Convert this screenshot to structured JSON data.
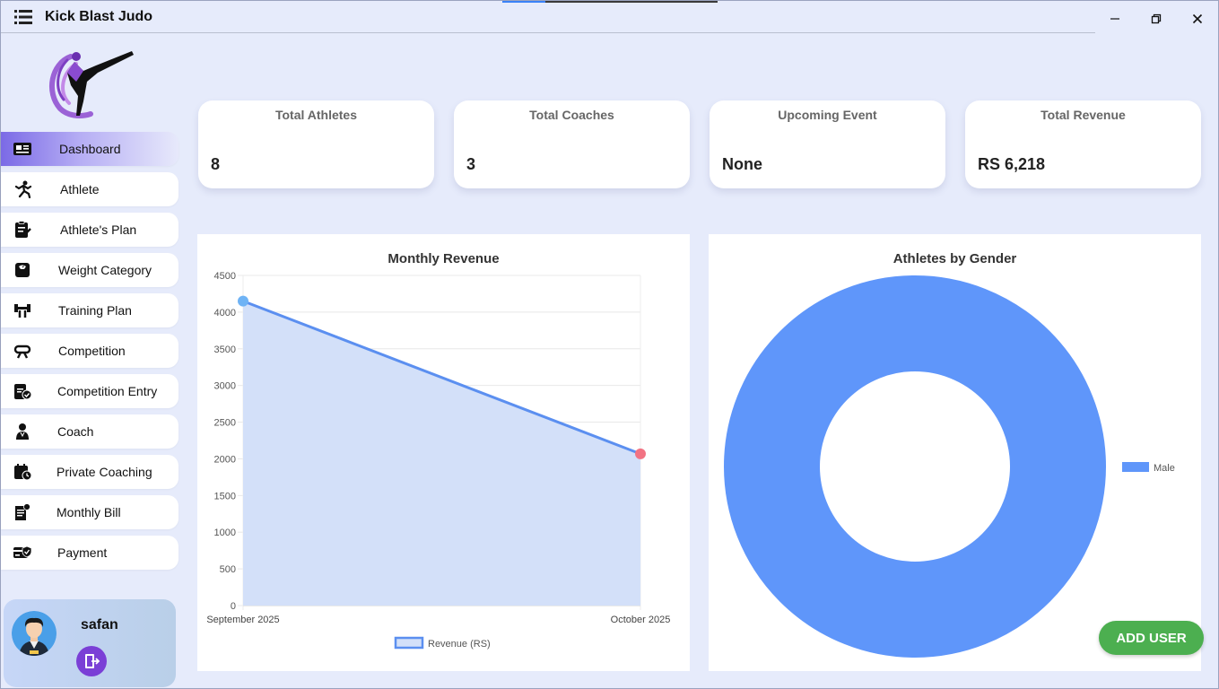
{
  "window": {
    "title": "Kick Blast Judo",
    "minimize_glyph": "—",
    "maximize_glyph": "❐",
    "close_glyph": "✕"
  },
  "sidebar": {
    "items": [
      {
        "label": "Dashboard",
        "icon": "dashboard-icon",
        "active": true
      },
      {
        "label": "Athlete",
        "icon": "athlete-icon"
      },
      {
        "label": "Athlete's Plan",
        "icon": "plan-icon"
      },
      {
        "label": "Weight Category",
        "icon": "scale-icon"
      },
      {
        "label": "Training Plan",
        "icon": "dumbbell-icon"
      },
      {
        "label": "Competition",
        "icon": "belt-icon"
      },
      {
        "label": "Competition Entry",
        "icon": "clipboard-check-icon"
      },
      {
        "label": "Coach",
        "icon": "coach-icon"
      },
      {
        "label": "Private Coaching",
        "icon": "calendar-clock-icon"
      },
      {
        "label": "Monthly Bill",
        "icon": "bill-icon"
      },
      {
        "label": "Payment",
        "icon": "payment-icon"
      }
    ]
  },
  "user": {
    "name": "safan"
  },
  "stats": [
    {
      "title": "Total Athletes",
      "value": "8"
    },
    {
      "title": "Total Coaches",
      "value": "3"
    },
    {
      "title": "Upcoming Event",
      "value": "None"
    },
    {
      "title": "Total Revenue",
      "value": "RS 6,218"
    }
  ],
  "add_user_label": "ADD USER",
  "chart_data": [
    {
      "type": "area",
      "title": "Monthly Revenue",
      "categories": [
        "September 2025",
        "October 2025"
      ],
      "series": [
        {
          "name": "Revenue (RS)",
          "values": [
            4150,
            2068
          ],
          "color": "#5b8ff0",
          "fill": "#d3e0f9",
          "point_colors": [
            "#6fb3f5",
            "#f27383"
          ]
        }
      ],
      "ylim": [
        0,
        4500
      ],
      "yticks": [
        0,
        500,
        1000,
        1500,
        2000,
        2500,
        3000,
        3500,
        4000,
        4500
      ],
      "legend": "bottom",
      "grid": true
    },
    {
      "type": "pie",
      "title": "Athletes by Gender",
      "categories": [
        "Male"
      ],
      "values": [
        8
      ],
      "colors": [
        "#5f96fa"
      ],
      "donut": true,
      "legend": "right"
    }
  ]
}
